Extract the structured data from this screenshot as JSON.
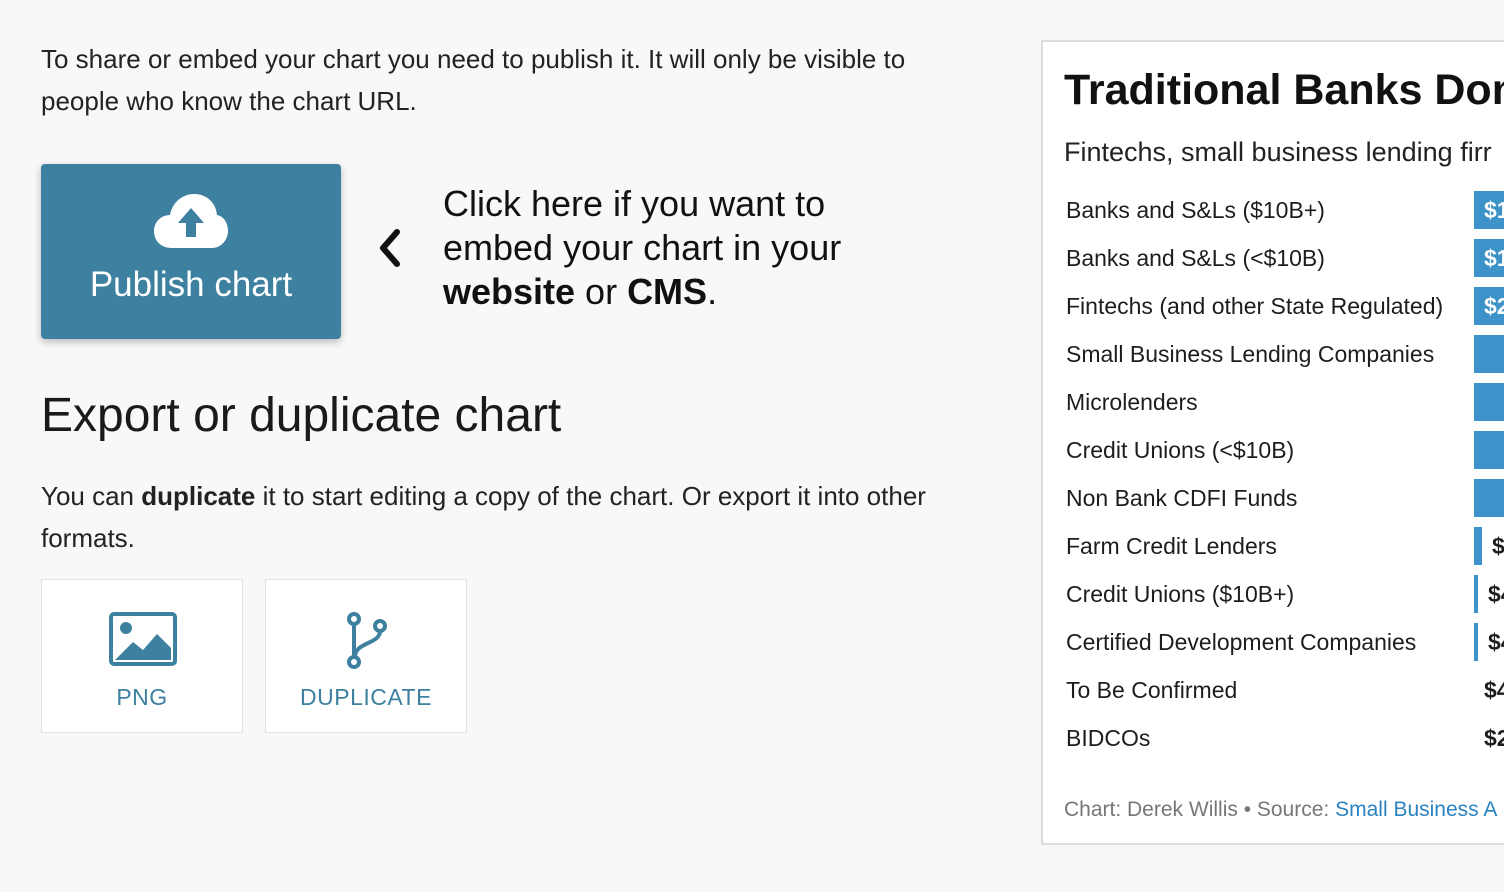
{
  "intro_text": "To share or embed your chart you need to publish it. It will only be visible to people who know the chart URL.",
  "publish": {
    "button_label": "Publish chart",
    "callout_start": "Click here if you want to embed your chart in your ",
    "callout_website": "website",
    "callout_or": " or ",
    "callout_cms": "CMS",
    "callout_end": "."
  },
  "export": {
    "title": "Export or duplicate chart",
    "text_before": "You can ",
    "text_bold": "duplicate",
    "text_after": " it to start editing a copy of the chart. Or export it into other formats.",
    "png_label": "PNG",
    "duplicate_label": "DUPLICATE"
  },
  "colors": {
    "accent": "#3d809f",
    "bar": "#3d93c9"
  },
  "icons": [
    "cloud-upload-icon",
    "chevron-left-icon",
    "image-icon",
    "fork-icon"
  ],
  "chart_data": {
    "type": "bar",
    "title": "Traditional Banks Dom",
    "subtitle": "Fintechs, small business lending firr",
    "categories": [
      "Banks and S&Ls ($10B+)",
      "Banks and S&Ls (<$10B)",
      "Fintechs (and other State Regulated)",
      "Small Business Lending Companies",
      "Microlenders",
      "Credit Unions (<$10B)",
      "Non Bank CDFI Funds",
      "Farm Credit Lenders",
      "Credit Unions ($10B+)",
      "Certified Development Companies",
      "To Be Confirmed",
      "BIDCOs"
    ],
    "value_labels": [
      "$1",
      "$1",
      "$2",
      "",
      "",
      "",
      "",
      "$",
      "$4",
      "$4",
      "$4",
      "$2"
    ],
    "values": [
      1,
      1,
      1,
      1,
      1,
      1,
      1,
      0.1,
      0.05,
      0.05,
      0,
      0
    ],
    "credit_prefix": "Chart: Derek Willis • Source: ",
    "credit_link": "Small Business A"
  }
}
